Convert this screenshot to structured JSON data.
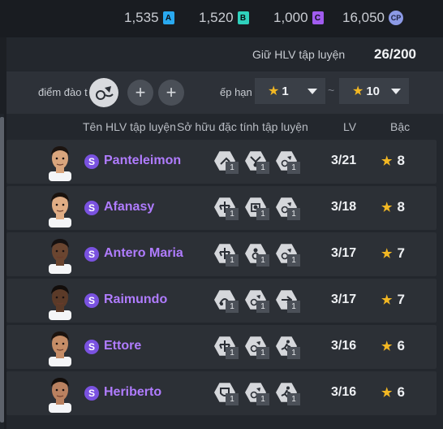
{
  "currencies": [
    {
      "value": "1,535",
      "badge": "A",
      "color": "#29a9f0"
    },
    {
      "value": "1,520",
      "badge": "B",
      "color": "#2fd1bd"
    },
    {
      "value": "1,000",
      "badge": "C",
      "color": "#a15cf0"
    },
    {
      "value": "16,050",
      "badge": "CP",
      "color": "#8c9ae6"
    }
  ],
  "hold": {
    "label": "Giữ HLV tập luyện",
    "value": "26/200"
  },
  "filter": {
    "training_label": "điểm đào t",
    "grade_label": "ếp hạn",
    "grade_min": "1",
    "tilde": "~",
    "grade_max": "10"
  },
  "columns": {
    "name": "Tên HLV tập luyện",
    "traits": "Sở hữu đặc tính tập luyện",
    "lv": "LV",
    "grade": "Bậc"
  },
  "rows": [
    {
      "name": "Panteleimon",
      "s_badge": "S",
      "lv": "3/21",
      "grade": "8",
      "skin": "#d9a57d",
      "hair": "#1c1410",
      "traits": [
        {
          "icon": "dribble-icon",
          "lvl": "1"
        },
        {
          "icon": "tackle-icon",
          "lvl": "1"
        },
        {
          "icon": "skill-move-icon",
          "lvl": "1"
        }
      ]
    },
    {
      "name": "Afanasy",
      "s_badge": "S",
      "lv": "3/18",
      "grade": "8",
      "skin": "#e0ad85",
      "hair": "#1a120d",
      "traits": [
        {
          "icon": "balance-icon",
          "lvl": "1"
        },
        {
          "icon": "goalkeeper-icon",
          "lvl": "1"
        },
        {
          "icon": "skill-move-icon",
          "lvl": "1"
        }
      ]
    },
    {
      "name": "Antero Maria",
      "s_badge": "S",
      "lv": "3/17",
      "grade": "7",
      "skin": "#6a4530",
      "hair": "#151010",
      "traits": [
        {
          "icon": "balance-icon",
          "lvl": "1"
        },
        {
          "icon": "ball-control-icon",
          "lvl": "1"
        },
        {
          "icon": "skill-move-icon",
          "lvl": "1"
        }
      ]
    },
    {
      "name": "Raimundo",
      "s_badge": "S",
      "lv": "3/17",
      "grade": "7",
      "skin": "#5b3a28",
      "hair": "#120d0b",
      "traits": [
        {
          "icon": "long-pass-icon",
          "lvl": "1"
        },
        {
          "icon": "skill-move-icon",
          "lvl": "1"
        },
        {
          "icon": "shooting-icon",
          "lvl": "1"
        }
      ]
    },
    {
      "name": "Ettore",
      "s_badge": "S",
      "lv": "3/16",
      "grade": "6",
      "skin": "#c58d67",
      "hair": "#1c130e",
      "traits": [
        {
          "icon": "balance-icon",
          "lvl": "1"
        },
        {
          "icon": "skill-move-icon",
          "lvl": "1"
        },
        {
          "icon": "running-icon",
          "lvl": "1"
        }
      ]
    },
    {
      "name": "Heriberto",
      "s_badge": "S",
      "lv": "3/16",
      "grade": "6",
      "skin": "#b98160",
      "hair": "#120d0a",
      "traits": [
        {
          "icon": "shielding-icon",
          "lvl": "1"
        },
        {
          "icon": "skill-move-icon",
          "lvl": "1"
        },
        {
          "icon": "running-icon",
          "lvl": "1"
        }
      ]
    }
  ]
}
